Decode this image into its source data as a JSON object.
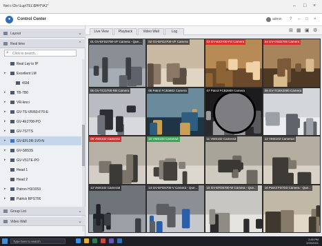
{
  "window": {
    "address": "Net c:\\Do:\\Lup\\TEL\\$HH*\\A1*",
    "controls": [
      "–",
      "□",
      "×"
    ]
  },
  "app": {
    "title": "Control Center",
    "user": "admin",
    "toolbar_icons": [
      "layout-icon",
      "grid-icon",
      "camera-icon",
      "settings-icon"
    ]
  },
  "sidebar": {
    "panel_top": {
      "label": "Layout"
    },
    "panel_devices": {
      "label": "Real time"
    },
    "search": {
      "placeholder": "Click to search..."
    },
    "tree": [
      {
        "label": "Real Lay to IP",
        "indent": 0,
        "icon": "list-icon",
        "expand": false,
        "selected": false
      },
      {
        "label": "Excellent LM",
        "indent": 0,
        "icon": "server-icon",
        "expand": true,
        "selected": false
      },
      {
        "label": "4SM",
        "indent": 1,
        "icon": "camera-icon",
        "expand": false,
        "selected": false
      },
      {
        "label": "TB-7B0",
        "indent": 0,
        "icon": "camera-icon",
        "expand": true,
        "selected": false
      },
      {
        "label": "VR-lenci",
        "indent": 0,
        "icon": "camera-icon",
        "expand": true,
        "selected": false
      },
      {
        "label": "GV-TS-VR/60-F70-E",
        "indent": 0,
        "icon": "camera-icon",
        "expand": true,
        "selected": false
      },
      {
        "label": "GV-4E2708-PO",
        "indent": 0,
        "icon": "camera-icon",
        "expand": true,
        "selected": false
      },
      {
        "label": "GV-7S7TS",
        "indent": 0,
        "icon": "camera-icon",
        "expand": true,
        "selected": false
      },
      {
        "label": "GV-EFL0R-1V0-N",
        "indent": 0,
        "icon": "camera-icon",
        "expand": true,
        "selected": true
      },
      {
        "label": "GV-S8S3S",
        "indent": 0,
        "icon": "camera-icon",
        "expand": true,
        "selected": false
      },
      {
        "label": "GV-V51TE-PO",
        "indent": 0,
        "icon": "camera-icon",
        "expand": true,
        "selected": false
      },
      {
        "label": "Head 1",
        "indent": 0,
        "icon": "camera-icon",
        "expand": false,
        "selected": false
      },
      {
        "label": "Head 2",
        "indent": 0,
        "icon": "camera-icon",
        "expand": false,
        "selected": false
      },
      {
        "label": "Patron H3/1053",
        "indent": 0,
        "icon": "camera-icon",
        "expand": true,
        "selected": false
      },
      {
        "label": "Patrick RPS706",
        "indent": 0,
        "icon": "camera-icon",
        "expand": true,
        "selected": false
      }
    ],
    "panel_group": {
      "label": "Group List"
    },
    "panel_video": {
      "label": "Video Wall"
    }
  },
  "main": {
    "tabs": [
      {
        "label": "Live View",
        "active": true
      },
      {
        "label": "Playback",
        "active": false
      },
      {
        "label": "Video Wall",
        "active": false
      },
      {
        "label": "Log",
        "active": false
      }
    ],
    "tiles": [
      {
        "label": "01 GV-EFD2700-VF Camera - Que...",
        "status": "normal",
        "scene": "parking"
      },
      {
        "label": "02 GV-EFD2700-VF Camera",
        "status": "normal",
        "scene": "office"
      },
      {
        "label": "03 GV-BX2700-FD Camera",
        "status": "alert",
        "scene": "warehouse"
      },
      {
        "label": "04 GV-VSD2700 Camera",
        "status": "alert",
        "scene": "warehouse2"
      },
      {
        "label": "05 GV-TC/2700-RB Camera",
        "status": "normal",
        "scene": "people"
      },
      {
        "label": "06 Patrol FCB3802 Camera",
        "status": "normal",
        "scene": "workers"
      },
      {
        "label": "07 Patrol FCB2800 Camera",
        "status": "normal",
        "scene": "fisheye"
      },
      {
        "label": "08 GV-TCBX2000 Camera",
        "status": "normal",
        "scene": "office2"
      },
      {
        "label": "09 VMS102 Camera1",
        "status": "alert",
        "scene": "lobby"
      },
      {
        "label": "10 VMS102 Camera2",
        "status": "ok",
        "scene": "lobby2"
      },
      {
        "label": "11 VMS102 Camera3",
        "status": "normal",
        "scene": "mall"
      },
      {
        "label": "12 VMS102 Camera4",
        "status": "normal",
        "scene": "shoppers"
      },
      {
        "label": "13 VMS102 Camera5",
        "status": "normal",
        "scene": "car"
      },
      {
        "label": "14 GV-EFD5700-V Camera - Que...",
        "status": "normal",
        "scene": "loading"
      },
      {
        "label": "15 GV-EFD5700-W Camera - Que...",
        "status": "normal",
        "scene": "business"
      },
      {
        "label": "16 Patrol FD7D3 Camera - Que...",
        "status": "normal",
        "scene": "store"
      }
    ]
  },
  "taskbar": {
    "search": "Type here to search",
    "time": "2:45 PM",
    "date": "2/20/2021"
  },
  "colors": {
    "alert": "#d93030",
    "ok": "#3aa65a",
    "accent": "#2b6fb6"
  }
}
